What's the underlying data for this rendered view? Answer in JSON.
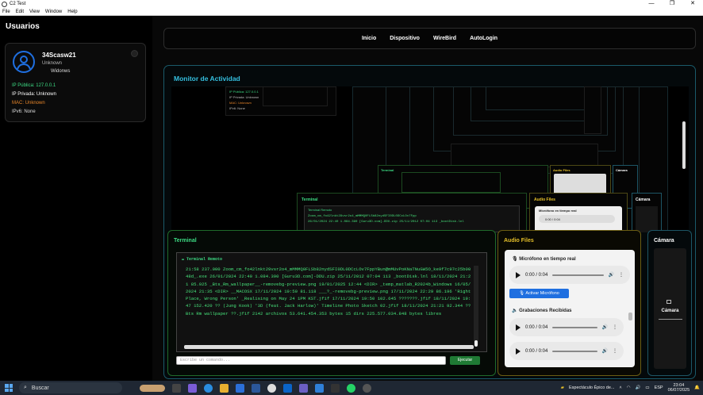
{
  "window": {
    "title": "C2 Test",
    "menu": [
      "File",
      "Edit",
      "View",
      "Window",
      "Help"
    ],
    "controls": [
      "—",
      "❐",
      "✕"
    ]
  },
  "sidebar": {
    "title": "Usuarios",
    "user": {
      "name": "34Scasw21",
      "status": "Unknown",
      "os": "Widonws",
      "public_ip": "IP Pública: 127.0.0.1",
      "private_ip": "IP Privada: Unknown",
      "mac": "MAC: Unknown",
      "ipv6": "IPv6: None"
    }
  },
  "nav": [
    "Inicio",
    "Dispositivo",
    "WireBird",
    "AutoLogin"
  ],
  "monitor": {
    "title": "Monitor de Actividad",
    "mirror": {
      "ip_public": "IP Pública: 127.0.0.1",
      "ip_private": "IP Privada: Unknown",
      "mac": "MAC: Unknown",
      "ipv6": "IPv6: None",
      "terminal": "Terminal",
      "audio": "Audio Files",
      "camera": "Cámara",
      "mic": "Micrófono en tiempo real",
      "time": "0:00 / 0:04",
      "term_head": "Terminal Remoto",
      "term_line1": "Zoom_cm_fo42lnkt29vsr2o4_mMMMQ0FLSb82nydSFI0DL0DCcLOv7Fpp",
      "term_line2": "26/01/2024 22:40 1.084.390 [Guru3D.com]-DDU.zip 25/11/2012 07:04 113 _bootDisk.lnl"
    }
  },
  "terminal": {
    "title": "Terminal",
    "header": "Terminal Remoto",
    "output": "21:58 237.000 Zoom_cm_fo42lnkt29vsr2o4_mMMMQ0FLSb82nydSFI0DL0DCcLOv7FppYBun@mMUvPoKNaTNuGW5O_ke9f7c97c25b0048d_.exe 26/01/2024 22:40 1.084.390 [Guru3D.com]-DDU.zip 25/11/2012 07:04 113 _bootDisk.lnl 18/11/2024 21:21 85.925 _Bts_Rm_wallpaper__-removebg-preview.png 19/01/2025 12:44 <DIR> _temp_matlab_R2024b_Windows 16/05/2024 21:35 <DIR> __MACOSX 17/11/2024 19:50 81.118 ___?_-removebg-preview.png 17/11/2024 22:29 86.196 'Right Place, Wrong Person' _Realising on May 24 1PM KST.jfif 17/11/2024 19:50 102.645 ???????.jfif 18/11/2024 19:47 152.420 ?? (Jung Kook) '3D (feat. Jack Harlow)' Timeline Photo Sketch 02.jfif 18/11/2024 21:21 92.344 ??Bts Rm wallpaper ??.jfif 2142 archivos 53.641.454.353 bytes 15 dirs 225.577.034.848 bytes libres",
    "input_placeholder": "Escribe un comando...",
    "run_label": "Ejecutar"
  },
  "audio": {
    "title": "Audio Files",
    "mic_label": "Micrófono en tiempo real",
    "player_time": "0:00 / 0:04",
    "activate_label": "Activar Micrófono",
    "recordings_label": "Grabaciones Recibidas",
    "recordings": [
      "0:00 / 0:04",
      "0:00 / 0:04"
    ]
  },
  "camera": {
    "title": "Cámara",
    "label": "Cámara"
  },
  "taskbar": {
    "search": "Buscar",
    "notification": "Espectáculo Épico de...",
    "lang": "ESP",
    "time": "23:04",
    "date": "06/07/2025"
  },
  "colors": {
    "accent_cyan": "#35c0e0",
    "terminal_green": "#3ddc84",
    "audio_gold": "#e6c02a",
    "ip_green": "#3ddc84",
    "mac_orange": "#e8862a",
    "button_blue": "#1f6fe0"
  }
}
